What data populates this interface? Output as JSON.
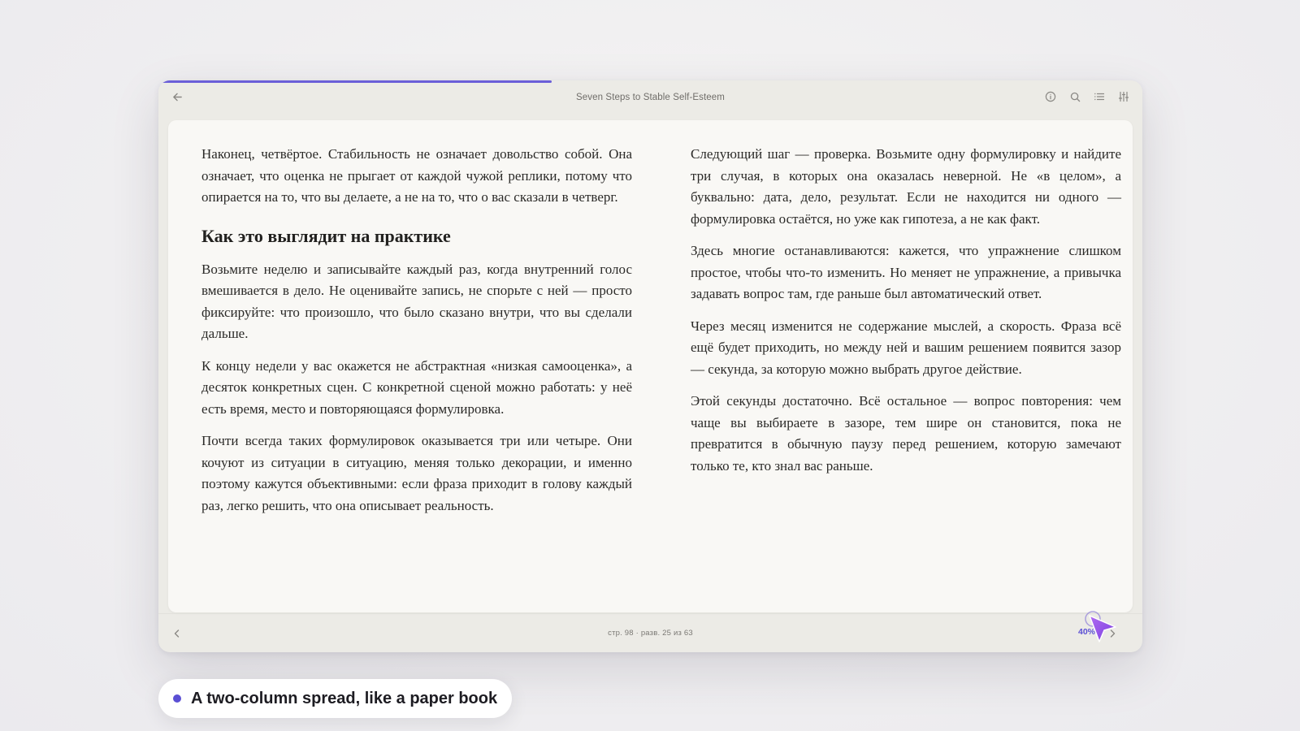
{
  "app": {
    "book_title": "Seven Steps to Stable Self-Esteem",
    "reading_progress": 0.4,
    "accent_color": "#5b4fd4"
  },
  "toolbar": {
    "back_icon": "arrow-left-icon",
    "icons": [
      "info-icon",
      "search-icon",
      "contents-list-icon",
      "settings-sliders-icon"
    ]
  },
  "left_column": {
    "p1": "Наконец, четвёртое. Стабильность не означает довольство собой. Она означает, что оценка не прыгает от каждой чужой реплики, потому что опирается на то, что вы делаете, а не на то, что о вас сказали в четверг.",
    "heading": "Как это выглядит на практике",
    "p2": "Возьмите неделю и записывайте каждый раз, когда внутренний голос вмешивается в дело. Не оценивайте запись, не спорьте с ней — просто фиксируйте: что произошло, что было сказано внутри, что вы сделали дальше.",
    "p3": "К концу недели у вас окажется не абстрактная «низкая самооценка», а десяток конкретных сцен. С конкретной сценой можно работать: у неё есть время, место и повторяющаяся формулировка.",
    "p4": "Почти всегда таких формулировок оказывается три или четыре. Они кочуют из ситуации в ситуацию, меняя только декорации, и именно поэтому кажутся объективными: если фраза приходит в голову каждый раз, легко решить, что она описывает реальность."
  },
  "right_column": {
    "p1": "Следующий шаг — проверка. Возьмите одну формулировку и найдите три случая, в которых она оказалась неверной. Не «в целом», а буквально: дата, дело, результат. Если не находится ни одного — формулировка остаётся, но уже как гипотеза, а не как факт.",
    "p2": "Здесь многие останавливаются: кажется, что упражнение слишком простое, чтобы что-то изменить. Но меняет не упражнение, а привычка задавать вопрос там, где раньше был автоматический ответ.",
    "p3": "Через месяц изменится не содержание мыслей, а скорость. Фраза всё ещё будет приходить, но между ней и вашим решением появится зазор — секунда, за которую можно выбрать другое действие.",
    "p4": "Этой секунды достаточно. Всё остальное — вопрос повторения: чем чаще вы выбираете в зазоре, тем шире он становится, пока не превратится в обычную паузу перед решением, которую замечают только те, кто знал вас раньше."
  },
  "footer": {
    "page_info": "стр. 98 · разв. 25 из 63",
    "percent": "40%",
    "prev_icon": "chevron-left-icon",
    "next_icon": "chevron-right-icon"
  },
  "caption": {
    "text": "A two-column spread, like a paper book"
  }
}
